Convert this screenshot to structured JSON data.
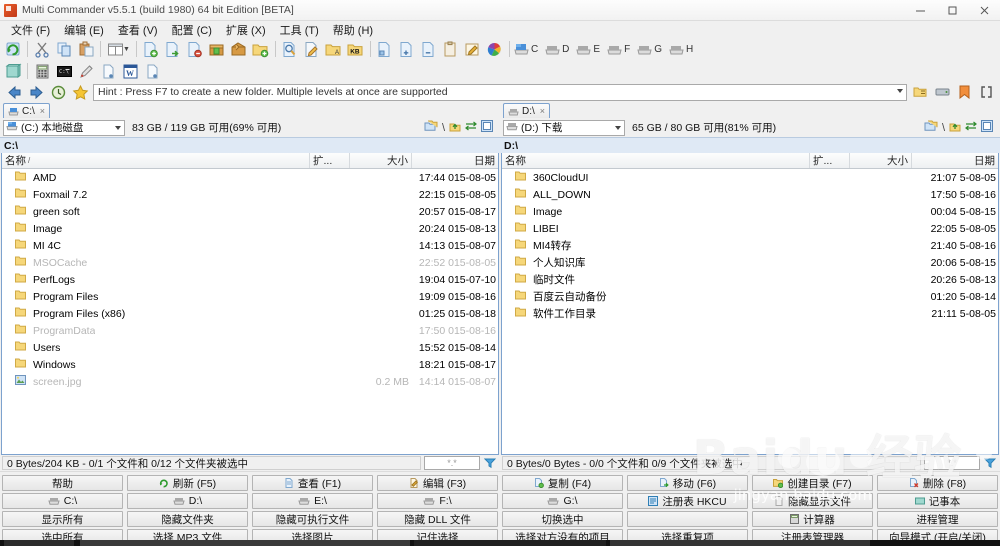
{
  "window": {
    "title": "Multi Commander v5.5.1 (build 1980) 64 bit Edition [BETA]",
    "minimize": "─",
    "maximize": "❐",
    "close": "✕"
  },
  "menu": {
    "items": [
      {
        "label": "文件 (F)"
      },
      {
        "label": "编辑 (E)"
      },
      {
        "label": "查看 (V)"
      },
      {
        "label": "配置 (C)"
      },
      {
        "label": "扩展 (X)"
      },
      {
        "label": "工具 (T)"
      },
      {
        "label": "帮助 (H)"
      }
    ]
  },
  "toolbar1": {
    "tools": [
      {
        "icon": "refresh-icon"
      },
      {
        "sep": true
      },
      {
        "icon": "cut-icon"
      },
      {
        "icon": "copy-icon"
      },
      {
        "icon": "paste-icon"
      },
      {
        "sep": true
      },
      {
        "icon": "dual-pane-icon"
      },
      {
        "icon": "dropdown-caret-icon"
      },
      {
        "sep": true
      },
      {
        "icon": "new-file-icon"
      },
      {
        "icon": "move-file-icon"
      },
      {
        "icon": "delete-file-icon"
      },
      {
        "icon": "pack-icon"
      },
      {
        "icon": "unpack-icon"
      },
      {
        "icon": "new-folder-icon"
      },
      {
        "sep": true
      },
      {
        "icon": "search-icon"
      },
      {
        "icon": "edit-icon"
      },
      {
        "icon": "folder-sync-icon"
      },
      {
        "icon": "kb-icon"
      },
      {
        "icon": "file-left-icon"
      },
      {
        "icon": "file-add-icon"
      },
      {
        "icon": "file-remove-icon"
      },
      {
        "icon": "clipboard-icon"
      },
      {
        "icon": "notes-icon"
      },
      {
        "icon": "color-wheel-icon"
      }
    ],
    "drives": [
      {
        "letter": "C",
        "icon": "drive-icon"
      },
      {
        "letter": "D",
        "icon": "drive-icon"
      },
      {
        "letter": "E",
        "icon": "drive-icon"
      },
      {
        "letter": "F",
        "icon": "drive-icon"
      },
      {
        "letter": "G",
        "icon": "drive-icon"
      },
      {
        "letter": "H",
        "icon": "drive-icon"
      }
    ]
  },
  "toolbar2": {
    "tools": [
      {
        "icon": "notepad-icon"
      },
      {
        "sep": true
      },
      {
        "icon": "calculator-icon"
      },
      {
        "icon": "console-icon"
      },
      {
        "icon": "pen-icon"
      },
      {
        "icon": "page-icon"
      },
      {
        "icon": "word-icon"
      },
      {
        "icon": "page2-icon"
      }
    ]
  },
  "hintbar": {
    "back_icon": "back-arrow-icon",
    "forward_icon": "forward-arrow-icon",
    "history_icon": "history-clock-icon",
    "favorites_icon": "star-icon",
    "text": "Hint : Press F7 to create a new folder. Multiple levels at once are supported",
    "right_tools": [
      {
        "icon": "folder-tree-icon"
      },
      {
        "icon": "hdd-icon"
      },
      {
        "icon": "bookmark-icon"
      },
      {
        "icon": "bracket-icon"
      }
    ]
  },
  "left_panel": {
    "tab": {
      "label": "C:\\",
      "icon": "drive-icon",
      "close": "×"
    },
    "drive_selector": {
      "value": "(C:) 本地磁盘",
      "icon": "drive-icon"
    },
    "space": "83 GB / 119 GB 可用(69% 可用)",
    "path": "C:\\",
    "columns": {
      "name": "名称",
      "sort": "/",
      "ext": "扩...",
      "size": "大小",
      "date": "日期"
    },
    "files": [
      {
        "name": "AMD",
        "ext": "",
        "size": "",
        "date": "015-08-05 17:44",
        "type": "folder",
        "dim": false
      },
      {
        "name": "Foxmail 7.2",
        "ext": "",
        "size": "",
        "date": "015-08-05 22:15",
        "type": "folder",
        "dim": false
      },
      {
        "name": "green soft",
        "ext": "",
        "size": "",
        "date": "015-08-17 20:57",
        "type": "folder",
        "dim": false
      },
      {
        "name": "Image",
        "ext": "",
        "size": "",
        "date": "015-08-13 20:24",
        "type": "folder",
        "dim": false
      },
      {
        "name": "MI 4C",
        "ext": "",
        "size": "",
        "date": "015-08-07 14:13",
        "type": "folder",
        "dim": false
      },
      {
        "name": "MSOCache",
        "ext": "",
        "size": "",
        "date": "015-08-05 22:52",
        "type": "folder",
        "dim": true
      },
      {
        "name": "PerfLogs",
        "ext": "",
        "size": "",
        "date": "015-07-10 19:04",
        "type": "folder",
        "dim": false
      },
      {
        "name": "Program Files",
        "ext": "",
        "size": "",
        "date": "015-08-16 19:09",
        "type": "folder",
        "dim": false
      },
      {
        "name": "Program Files (x86)",
        "ext": "",
        "size": "",
        "date": "015-08-18 01:25",
        "type": "folder",
        "dim": false
      },
      {
        "name": "ProgramData",
        "ext": "",
        "size": "",
        "date": "015-08-16 17:50",
        "type": "folder",
        "dim": true
      },
      {
        "name": "Users",
        "ext": "",
        "size": "",
        "date": "015-08-14 15:52",
        "type": "folder",
        "dim": false
      },
      {
        "name": "Windows",
        "ext": "",
        "size": "",
        "date": "015-08-17 18:21",
        "type": "folder",
        "dim": false
      },
      {
        "name": "screen.jpg",
        "ext": "",
        "size": "0.2 MB",
        "date": "015-08-07 14:14",
        "type": "image",
        "dim": true
      }
    ],
    "status": "0 Bytes/204 KB - 0/1 个文件和 0/12 个文件夹被选中",
    "filter_placeholder": "*.*"
  },
  "right_panel": {
    "tab": {
      "label": "D:\\",
      "icon": "drive-icon",
      "close": "×"
    },
    "drive_selector": {
      "value": "(D:) 下载",
      "icon": "drive-icon"
    },
    "space": "65 GB / 80 GB 可用(81% 可用)",
    "path": "D:\\",
    "columns": {
      "name": "名称",
      "sort": "",
      "ext": "扩...",
      "size": "大小",
      "date": "日期"
    },
    "files": [
      {
        "name": "360CloudUI",
        "ext": "",
        "size": "",
        "date": "5-08-05 21:07",
        "type": "folder",
        "dim": false
      },
      {
        "name": "ALL_DOWN",
        "ext": "",
        "size": "",
        "date": "5-08-16 17:50",
        "type": "folder",
        "dim": false
      },
      {
        "name": "Image",
        "ext": "",
        "size": "",
        "date": "5-08-15 00:04",
        "type": "folder",
        "dim": false
      },
      {
        "name": "LIBEI",
        "ext": "",
        "size": "",
        "date": "5-08-05 22:05",
        "type": "folder",
        "dim": false
      },
      {
        "name": "MI4转存",
        "ext": "",
        "size": "",
        "date": "5-08-16 21:40",
        "type": "folder",
        "dim": false
      },
      {
        "name": "个人知识库",
        "ext": "",
        "size": "",
        "date": "5-08-15 20:06",
        "type": "folder",
        "dim": false
      },
      {
        "name": "临时文件",
        "ext": "",
        "size": "",
        "date": "5-08-13 20:26",
        "type": "folder",
        "dim": false
      },
      {
        "name": "百度云自动备份",
        "ext": "",
        "size": "",
        "date": "5-08-14 01:20",
        "type": "folder",
        "dim": false
      },
      {
        "name": "软件工作目录",
        "ext": "",
        "size": "",
        "date": "5-08-05 21:11",
        "type": "folder",
        "dim": false
      }
    ],
    "status": "0 Bytes/0 Bytes - 0/0 个文件和 0/9 个文件夹被选中",
    "filter_placeholder": "*.*"
  },
  "button_panel": {
    "rows": [
      [
        {
          "label": "帮助",
          "icon": ""
        },
        {
          "label": "刷新 (F5)",
          "icon": "refresh-icon"
        },
        {
          "label": "查看 (F1)",
          "icon": "view-icon"
        },
        {
          "label": "编辑 (F3)",
          "icon": "edit-icon"
        },
        {
          "label": "复制 (F4)",
          "icon": "copy-icon"
        },
        {
          "label": "移动 (F6)",
          "icon": "move-icon"
        },
        {
          "label": "创建目录 (F7)",
          "icon": "new-folder-icon"
        },
        {
          "label": "删除 (F8)",
          "icon": "delete-icon"
        }
      ],
      [
        {
          "label": "C:\\",
          "icon": "drive-icon"
        },
        {
          "label": "D:\\",
          "icon": "drive-icon"
        },
        {
          "label": "E:\\",
          "icon": "drive-icon"
        },
        {
          "label": "F:\\",
          "icon": "drive-icon"
        },
        {
          "label": "G:\\",
          "icon": "drive-icon"
        },
        {
          "label": "注册表 HKCU",
          "icon": "registry-icon"
        },
        {
          "label": "隐藏显示文件",
          "icon": "hidden-file-icon"
        },
        {
          "label": "记事本",
          "icon": "notepad-icon"
        }
      ],
      [
        {
          "label": "显示所有",
          "icon": ""
        },
        {
          "label": "隐藏文件夹",
          "icon": ""
        },
        {
          "label": "隐藏可执行文件",
          "icon": ""
        },
        {
          "label": "隐藏 DLL 文件",
          "icon": ""
        },
        {
          "label": "切换选中",
          "icon": ""
        },
        {
          "label": "",
          "icon": ""
        },
        {
          "label": "计算器",
          "icon": "calculator-icon"
        },
        {
          "label": "进程管理",
          "icon": ""
        }
      ],
      [
        {
          "label": "选中所有",
          "icon": ""
        },
        {
          "label": "选择 MP3 文件",
          "icon": ""
        },
        {
          "label": "选择图片",
          "icon": ""
        },
        {
          "label": "记住选择",
          "icon": ""
        },
        {
          "label": "选择对方没有的项目",
          "icon": ""
        },
        {
          "label": "选择重复项",
          "icon": ""
        },
        {
          "label": "注册表管理器",
          "icon": ""
        },
        {
          "label": "向导模式 (开启/关闭)",
          "icon": ""
        }
      ]
    ]
  },
  "watermark": {
    "big": "Baidu 经验",
    "small": "jingyan.baidu.com"
  },
  "colors": {
    "panel_border": "#7da2ce",
    "path_bar": "#dfe9f5",
    "folder": "#f6d77a",
    "chrome": "#f0f0f0"
  }
}
